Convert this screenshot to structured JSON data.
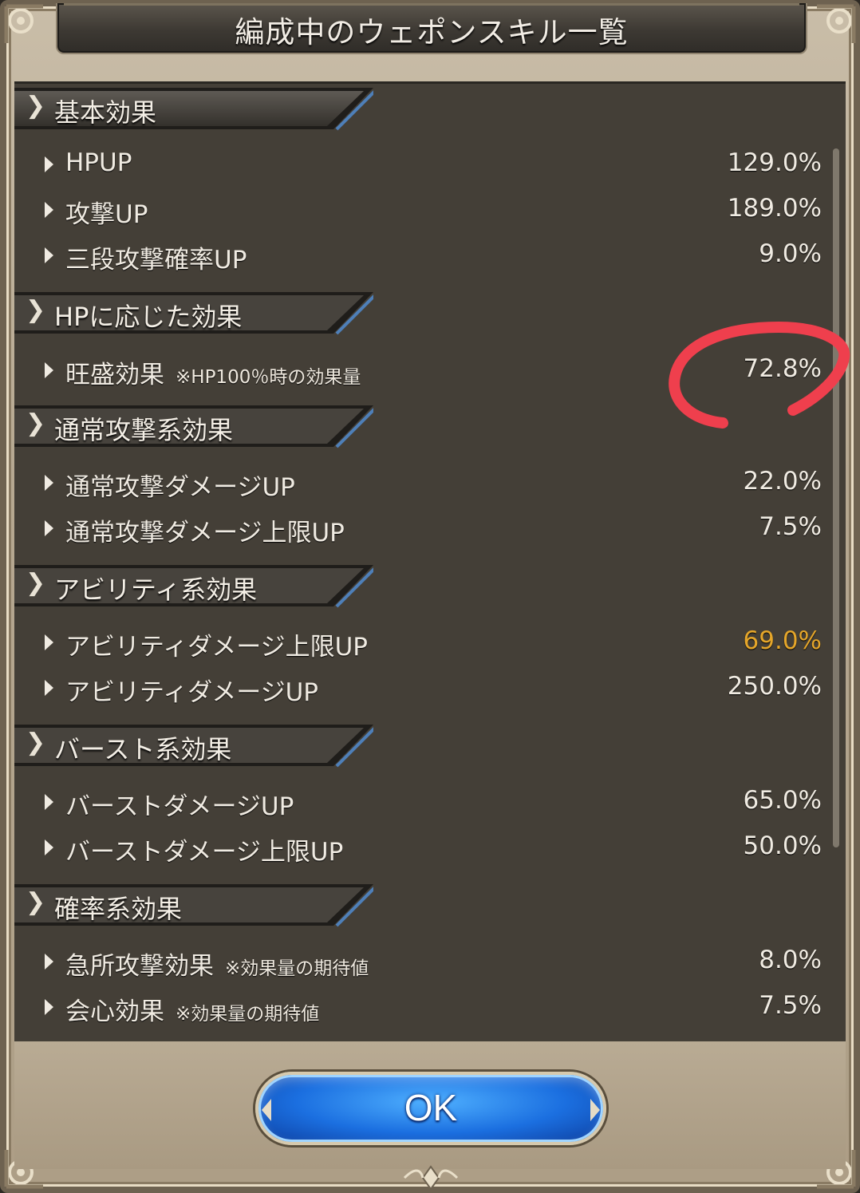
{
  "dialog": {
    "title": "編成中のウェポンスキル一覧",
    "ok_label": "OK"
  },
  "icons": {
    "section": "chevron-right-icon",
    "row": "triangle-right-icon"
  },
  "colors": {
    "panel_bg": "#443f37",
    "text": "#f0ebe2",
    "highlight_value": "#e5a62a",
    "annotation": "#ef3f4d",
    "ok_button": "#1b6fe0"
  },
  "sections": [
    {
      "label": "基本効果",
      "rows": [
        {
          "label": "HPUP",
          "note": "",
          "value": "129.0%"
        },
        {
          "label": "攻撃UP",
          "note": "",
          "value": "189.0%"
        },
        {
          "label": "三段攻撃確率UP",
          "note": "",
          "value": "9.0%"
        }
      ]
    },
    {
      "label": "HPに応じた効果",
      "rows": [
        {
          "label": "旺盛効果",
          "note": "※HP100％時の効果量",
          "value": "72.8%"
        }
      ]
    },
    {
      "label": "通常攻撃系効果",
      "rows": [
        {
          "label": "通常攻撃ダメージUP",
          "note": "",
          "value": "22.0%"
        },
        {
          "label": "通常攻撃ダメージ上限UP",
          "note": "",
          "value": "7.5%"
        }
      ]
    },
    {
      "label": "アビリティ系効果",
      "rows": [
        {
          "label": "アビリティダメージ上限UP",
          "note": "",
          "value": "69.0%"
        },
        {
          "label": "アビリティダメージUP",
          "note": "",
          "value": "250.0%"
        }
      ]
    },
    {
      "label": "バースト系効果",
      "rows": [
        {
          "label": "バーストダメージUP",
          "note": "",
          "value": "65.0%"
        },
        {
          "label": "バーストダメージ上限UP",
          "note": "",
          "value": "50.0%"
        }
      ]
    },
    {
      "label": "確率系効果",
      "rows": [
        {
          "label": "急所攻撃効果",
          "note": "※効果量の期待値",
          "value": "8.0%"
        },
        {
          "label": "会心効果",
          "note": "※効果量の期待値",
          "value": "7.5%"
        }
      ]
    }
  ]
}
